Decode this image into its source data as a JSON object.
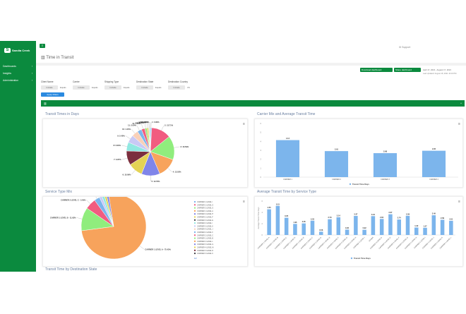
{
  "brand": {
    "name": "Sandia Creek",
    "accent": "#0b8a3e"
  },
  "sidebar": {
    "items": [
      {
        "label": "Dashboards",
        "icon": "dashboard-icon"
      },
      {
        "label": "Insights",
        "icon": "chart-icon"
      },
      {
        "label": "Administration",
        "icon": "user-icon"
      }
    ]
  },
  "header": {
    "menu_icon": "hamburger-icon",
    "support": "Support"
  },
  "page": {
    "title": "Time in Transit"
  },
  "toolbar": {
    "download": "Download dashboard",
    "share": "Share dashboard",
    "date_range": "April 17, 2021 - August 17, 2021",
    "last_updated": "Last Updated: August 18, 2021 10:16 PM"
  },
  "filters": [
    {
      "label": "Client Name",
      "value": "Include",
      "mode": "Equals"
    },
    {
      "label": "Carrier",
      "value": "Include",
      "mode": "Equals"
    },
    {
      "label": "Shipping Type",
      "value": "Include",
      "mode": "Equals"
    },
    {
      "label": "Destination State",
      "value": "Include",
      "mode": "Equals"
    },
    {
      "label": "Destination Country",
      "value": "Include",
      "mode": "US"
    }
  ],
  "apply_filters": "Apply Filters",
  "section_toggle": "^",
  "chart_data": [
    {
      "type": "pie",
      "title": "Transit Times in Days",
      "categories": [
        "1",
        "2",
        "3",
        "4",
        "5",
        "6",
        "7",
        "8",
        "9",
        "10",
        "11",
        "12",
        "13",
        "14",
        "15",
        "16"
      ],
      "values": [
        0.89,
        13.71,
        16.59,
        13.53,
        12.79,
        10.09,
        9.87,
        6.09,
        5.4,
        4.4,
        3.0,
        2.3,
        1.5,
        1.14,
        0.8,
        0.5
      ],
      "labels": [
        "1: 0.89%",
        "2: 13.71%",
        "3: 16.59%",
        "4: 13.53%",
        "5: 12.79%",
        "6: 10.09%",
        "7: 9.87%",
        "8: 6.09%",
        "9: 5.40%",
        "10: 4.40%",
        "11: 3.00%",
        "12: 2.30%",
        "13: 1.50%",
        "14: 1.14%",
        "15: 0.80%",
        "16: 0.50%"
      ],
      "colors": [
        "#7cb5ec",
        "#f15c80",
        "#90ed7d",
        "#f7a35c",
        "#8085e9",
        "#e4d354",
        "#7b2f3e",
        "#91e8e1",
        "#c9c9f5",
        "#f9d0b8",
        "#7cb5ec",
        "#f15c80",
        "#a0e080",
        "#e4d354",
        "#d0d0d0",
        "#91e8e1"
      ]
    },
    {
      "type": "bar",
      "title": "Carrier Mix and Average Transit Time",
      "categories": [
        "CARRIER 1",
        "CARRIER 2",
        "CARRIER 3",
        "CARRIER 4"
      ],
      "series": [
        {
          "name": "Transit Time Days",
          "values": [
            4.14,
            2.91,
            2.68,
            2.95
          ]
        }
      ],
      "ylim": [
        0,
        6
      ],
      "yticks": [
        0,
        1,
        2,
        3,
        4,
        5,
        6
      ],
      "color": "#7cb5ec"
    },
    {
      "type": "pie",
      "title": "Service Type Mix",
      "categories": [
        "CARRIER 1 LEVEL A",
        "CARRIER 1 LEVEL B",
        "CARRIER 2 LEVEL C",
        "CARRIER 4 LEVEL J",
        "CARRIER 1 LEVEL E",
        "CARRIER 2 LEVEL H",
        "CARRIER 3 LEVEL F",
        "CARRIER 2 LEVEL D"
      ],
      "values": [
        75.43,
        11.63,
        5.45,
        2.75,
        1.32,
        1.27,
        1.11,
        1.04
      ],
      "labels": [
        "CARRIER 1 LEVEL A - 75.43%",
        "CARRIER 1 LEVEL B - 11.63%",
        "CARRIER 2 LEVEL C - 5.45%",
        "CARRIER 4 LEVEL J - 2.75%",
        "CARRIER 1 LEVEL E - 1.32%",
        "CARRIER 2 LEVEL H - 1.27%",
        "CARRIER 3 LEVEL F - 1.11%",
        "CARRIER 2 LEVEL D - 1.04%"
      ],
      "colors": [
        "#f7a35c",
        "#90ed7d",
        "#f15c80",
        "#7cb5ec",
        "#c9c9f5",
        "#91e8e1",
        "#e4d354",
        "#8085e9"
      ],
      "legend": [
        "CARRIER 1 LEVEL I",
        "CARRIER 2 LEVEL G",
        "CARRIER 3 LEVEL G",
        "CARRIER 1 LEVEL A",
        "CARRIER 4 LEVEL H",
        "CARRIER 2 LEVEL F",
        "CARRIER 3 LEVEL E",
        "CARRIER 2 LEVEL I",
        "CARRIER 3 LEVEL K",
        "CARRIER 4 LEVEL J",
        "CARRIER 2 LEVEL F",
        "CARRIER 2 LEVEL C",
        "CARRIER 1 LEVEL B",
        "CARRIER 2 LEVEL L",
        "CARRIER 3 LEVEL G",
        "CARRIER 4 LEVEL M",
        "CARRIER 3 LEVEL D",
        "CARRIER 3 LEVEL K"
      ],
      "legend_colors": [
        "#7cb5ec",
        "#f15c80",
        "#90ed7d",
        "#f7a35c",
        "#8085e9",
        "#e4d354",
        "#434348",
        "#91e8e1",
        "#c9c9f5",
        "#f9d0b8",
        "#7cb5ec",
        "#f15c80",
        "#90ed7d",
        "#f7a35c",
        "#8085e9",
        "#e4d354",
        "#7b2f3e",
        "#434348"
      ],
      "legend_page": "1/2",
      "legend_position": "right"
    },
    {
      "type": "bar",
      "title": "Average Transit Time by Service Type",
      "ylabel": "Average Transit Time Days",
      "categories": [
        "CARRIER 1 LEVEL A",
        "CARRIER 1 LEVEL B",
        "CARRIER 1 LEVEL C",
        "CARRIER 1 LEVEL D",
        "CARRIER 1 LEVEL E",
        "CARRIER 2 LEVEL C",
        "CARRIER 2 LEVEL D",
        "CARRIER 2 LEVEL E",
        "CARRIER 2 LEVEL F",
        "CARRIER 2 LEVEL G",
        "CARRIER 2 LEVEL H",
        "CARRIER 2 LEVEL I",
        "OTHER",
        "CARRIER 3 LEVEL D",
        "CARRIER 3 LEVEL E",
        "CARRIER 3 LEVEL F",
        "CARRIER 3 LEVEL G",
        "CARRIER 4 LEVEL H",
        "CARRIER 4 LEVEL I",
        "CARRIER 4 LEVEL J",
        "CARRIER 4 LEVEL K",
        "CARRIER 4 LEVEL L"
      ],
      "series": [
        {
          "name": "Transit Time Days",
          "values": [
            4.55,
            5.15,
            3.05,
            1.96,
            2.05,
            2.53,
            0.58,
            2.79,
            3.14,
            0.95,
            3.37,
            0.92,
            3.34,
            2.84,
            3.67,
            2.74,
            3.39,
            1.32,
            1.27,
            3.49,
            2.69,
            2.51
          ]
        }
      ],
      "ylim": [
        0,
        6
      ],
      "yticks": [
        0,
        2,
        4,
        6
      ],
      "color": "#7cb5ec"
    }
  ],
  "next_section": "Transit Time by Destination State"
}
